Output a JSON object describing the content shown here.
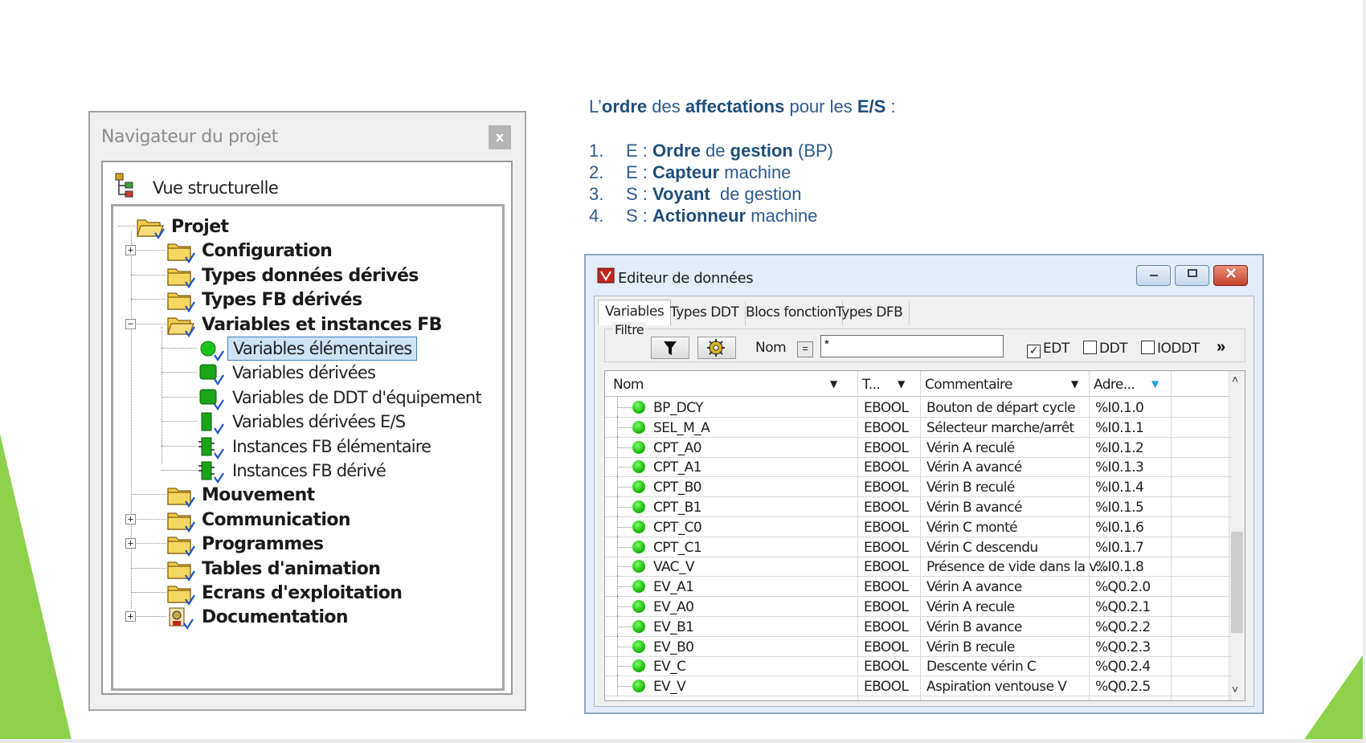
{
  "navigator": {
    "title": "Navigateur du projet",
    "close_label": "x",
    "view_label": "Vue structurelle",
    "tree": [
      {
        "label": "Projet",
        "level": 0,
        "icon": "folder-open-icon",
        "bold": true
      },
      {
        "label": "Configuration",
        "level": 1,
        "icon": "folder-icon",
        "bold": true,
        "expander": "+"
      },
      {
        "label": "Types données dérivés",
        "level": 1,
        "icon": "folder-icon",
        "bold": true
      },
      {
        "label": "Types FB dérivés",
        "level": 1,
        "icon": "folder-icon",
        "bold": true
      },
      {
        "label": "Variables et instances FB",
        "level": 1,
        "icon": "folder-open-icon",
        "bold": true,
        "expander": "−"
      },
      {
        "label": "Variables élémentaires",
        "level": 2,
        "icon": "green-dot-icon",
        "bold": false,
        "selected": true
      },
      {
        "label": "Variables dérivées",
        "level": 2,
        "icon": "green-square-icon",
        "bold": false
      },
      {
        "label": "Variables de DDT d'équipement",
        "level": 2,
        "icon": "green-square-icon",
        "bold": false
      },
      {
        "label": "Variables dérivées E/S",
        "level": 2,
        "icon": "green-bar-icon",
        "bold": false
      },
      {
        "label": "Instances FB élémentaire",
        "level": 2,
        "icon": "fb-icon",
        "bold": false
      },
      {
        "label": "Instances FB dérivé",
        "level": 2,
        "icon": "fb-icon",
        "bold": false
      },
      {
        "label": "Mouvement",
        "level": 1,
        "icon": "folder-icon",
        "bold": true
      },
      {
        "label": "Communication",
        "level": 1,
        "icon": "folder-icon",
        "bold": true,
        "expander": "+"
      },
      {
        "label": "Programmes",
        "level": 1,
        "icon": "folder-icon",
        "bold": true,
        "expander": "+"
      },
      {
        "label": "Tables d'animation",
        "level": 1,
        "icon": "folder-icon",
        "bold": true
      },
      {
        "label": "Ecrans d'exploitation",
        "level": 1,
        "icon": "folder-icon",
        "bold": true
      },
      {
        "label": "Documentation",
        "level": 1,
        "icon": "documentation-icon",
        "bold": true,
        "expander": "+"
      }
    ]
  },
  "info": {
    "heading_parts": [
      "L’",
      "ordre",
      " des ",
      "affectations",
      " pour les ",
      "E/S",
      " :"
    ],
    "items": [
      {
        "num": "1.",
        "parts": [
          "E : ",
          "Ordre",
          " de ",
          "gestion",
          " (BP)"
        ]
      },
      {
        "num": "2.",
        "parts": [
          "E : ",
          "Capteur",
          " machine",
          "",
          ""
        ]
      },
      {
        "num": "3.",
        "parts": [
          "S : ",
          "Voyant",
          "  de gestion",
          "",
          ""
        ]
      },
      {
        "num": "4.",
        "parts": [
          "S : ",
          "Actionneur",
          " machine",
          "",
          ""
        ]
      }
    ]
  },
  "editor": {
    "title": "Editeur de données",
    "tabs": [
      "Variables",
      "Types DDT",
      "Blocs fonction",
      "Types DFB"
    ],
    "filter_label": "Filtre",
    "nom_label": "Nom",
    "eq_label": "=",
    "filter_value": "*",
    "checkboxes": [
      {
        "label": "EDT",
        "checked": true
      },
      {
        "label": "DDT",
        "checked": false
      },
      {
        "label": "IODDT",
        "checked": false
      }
    ],
    "more_label": "»",
    "columns": [
      "Nom",
      "T...",
      "Commentaire",
      "Adre..."
    ],
    "rows": [
      {
        "nom": "BP_DCY",
        "type": "EBOOL",
        "comment": "Bouton de départ cycle",
        "addr": "%I0.1.0"
      },
      {
        "nom": "SEL_M_A",
        "type": "EBOOL",
        "comment": "Sélecteur marche/arrêt",
        "addr": "%I0.1.1"
      },
      {
        "nom": "CPT_A0",
        "type": "EBOOL",
        "comment": "Vérin A reculé",
        "addr": "%I0.1.2"
      },
      {
        "nom": "CPT_A1",
        "type": "EBOOL",
        "comment": "Vérin A avancé",
        "addr": "%I0.1.3"
      },
      {
        "nom": "CPT_B0",
        "type": "EBOOL",
        "comment": "Vérin B reculé",
        "addr": "%I0.1.4"
      },
      {
        "nom": "CPT_B1",
        "type": "EBOOL",
        "comment": "Vérin B avancé",
        "addr": "%I0.1.5"
      },
      {
        "nom": "CPT_C0",
        "type": "EBOOL",
        "comment": "Vérin C monté",
        "addr": "%I0.1.6"
      },
      {
        "nom": "CPT_C1",
        "type": "EBOOL",
        "comment": "Vérin C descendu",
        "addr": "%I0.1.7"
      },
      {
        "nom": "VAC_V",
        "type": "EBOOL",
        "comment": "Présence de vide dans la v...",
        "addr": "%I0.1.8"
      },
      {
        "nom": "EV_A1",
        "type": "EBOOL",
        "comment": "Vérin A avance",
        "addr": "%Q0.2.0"
      },
      {
        "nom": "EV_A0",
        "type": "EBOOL",
        "comment": "Vérin A recule",
        "addr": "%Q0.2.1"
      },
      {
        "nom": "EV_B1",
        "type": "EBOOL",
        "comment": "Vérin B avance",
        "addr": "%Q0.2.2"
      },
      {
        "nom": "EV_B0",
        "type": "EBOOL",
        "comment": "Vérin B recule",
        "addr": "%Q0.2.3"
      },
      {
        "nom": "EV_C",
        "type": "EBOOL",
        "comment": "Descente vérin C",
        "addr": "%Q0.2.4"
      },
      {
        "nom": "EV_V",
        "type": "EBOOL",
        "comment": "Aspiration ventouse V",
        "addr": "%Q0.2.5"
      }
    ]
  },
  "colors": {
    "text_blue": "#2e5a8f",
    "slide_green": "#8ed14a",
    "selection": "#cfe3f6"
  }
}
